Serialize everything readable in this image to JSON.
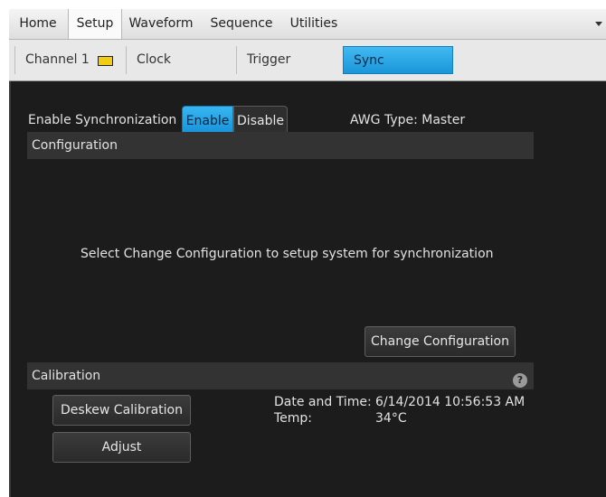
{
  "menu": {
    "items": [
      {
        "label": "Home"
      },
      {
        "label": "Setup",
        "active": true
      },
      {
        "label": "Waveform"
      },
      {
        "label": "Sequence"
      },
      {
        "label": "Utilities"
      }
    ]
  },
  "subtabs": {
    "channel1": "Channel 1",
    "channel1_color": "#f2cc12",
    "clock": "Clock",
    "trigger": "Trigger",
    "sync": "Sync",
    "active": "Sync"
  },
  "sync": {
    "enable_label": "Enable Synchronization",
    "enable_button": "Enable",
    "disable_button": "Disable",
    "selected": "Enable",
    "awg_type": "AWG Type: Master"
  },
  "configuration": {
    "header": "Configuration",
    "message": "Select Change Configuration to setup system for synchronization",
    "change_button": "Change Configuration"
  },
  "calibration": {
    "header": "Calibration",
    "help_icon": "?",
    "deskew_button": "Deskew Calibration",
    "adjust_button": "Adjust",
    "date_time_label": "Date and Time:",
    "date_time_value": "6/14/2014  10:56:53 AM",
    "temp_label": "Temp:",
    "temp_value": "34°C"
  },
  "colors": {
    "accent": "#1fa3e6",
    "panel_bg": "#1c1c1c",
    "section_bg": "#333333"
  }
}
